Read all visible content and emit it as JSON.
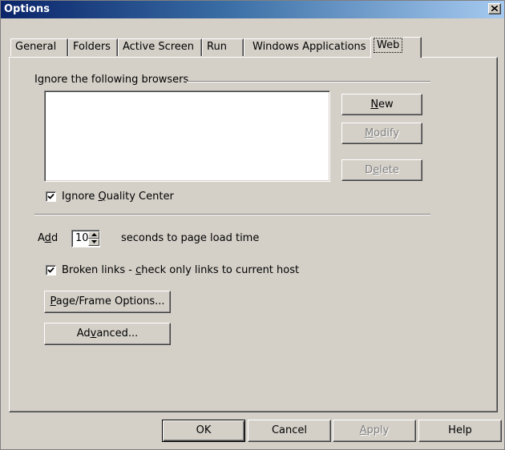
{
  "window": {
    "title": "Options"
  },
  "tabs": [
    {
      "label": "General"
    },
    {
      "label": "Folders"
    },
    {
      "label": "Active Screen"
    },
    {
      "label": "Run"
    },
    {
      "label": "Windows Applications"
    },
    {
      "label": "Web"
    }
  ],
  "active_tab": "Web",
  "browsers": {
    "group_label": "Ignore the following browsers",
    "items": [],
    "new_button": {
      "before": "",
      "key": "N",
      "after": "ew"
    },
    "modify_button": {
      "before": "",
      "key": "M",
      "after": "odify"
    },
    "delete_button": {
      "before": "D",
      "key": "e",
      "after": "lete"
    }
  },
  "ignore_quality_center": {
    "checked": true,
    "before": "Ignore ",
    "key": "Q",
    "after": "uality Center"
  },
  "page_load": {
    "prefix_before": "A",
    "prefix_key": "d",
    "prefix_after": "d",
    "value": "10",
    "suffix": "seconds to page load time"
  },
  "broken_links": {
    "checked": true,
    "before": "Broken links - ",
    "key": "c",
    "after": "heck only links to current host"
  },
  "page_frame_button": {
    "before": "",
    "key": "P",
    "after": "age/Frame Options..."
  },
  "advanced_button": {
    "before": "Ad",
    "key": "v",
    "after": "anced..."
  },
  "footer": {
    "ok": "OK",
    "cancel": "Cancel",
    "apply_key": "A",
    "apply_rest": "pply",
    "help": "Help"
  }
}
